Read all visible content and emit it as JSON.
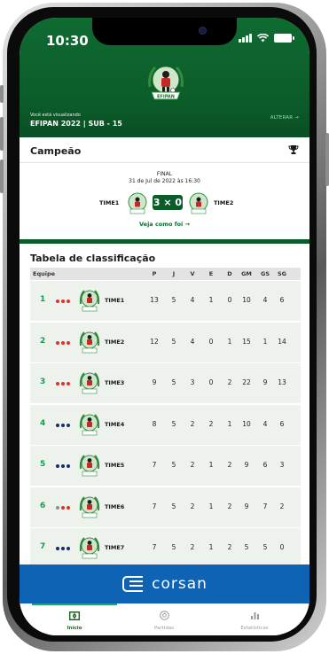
{
  "status": {
    "time": "10:30"
  },
  "header": {
    "logo_text": "EFIPAN",
    "viewing_label": "Você está visualizando",
    "viewing_value": "EFIPAN 2022 | SUB - 15",
    "change_label": "ALTERAR →"
  },
  "champion": {
    "title": "Campeão",
    "icon": "trophy-icon",
    "stage": "FINAL",
    "date": "31 de Jul de 2022 às 16:30",
    "home_team": "TIME1",
    "away_team": "TIME2",
    "score": "3 × 0",
    "see_how_label": "Veja como foi  →"
  },
  "standings": {
    "title": "Tabela de classificação",
    "columns": [
      "Equipe",
      "P",
      "J",
      "V",
      "E",
      "D",
      "GM",
      "GS",
      "SG"
    ],
    "rows": [
      {
        "pos": "1",
        "team": "TIME1",
        "form": [
          "#e0302b",
          "#e0302b",
          "#e0302b"
        ],
        "P": "13",
        "J": "5",
        "V": "4",
        "E": "1",
        "D": "0",
        "GM": "10",
        "GS": "4",
        "SG": "6"
      },
      {
        "pos": "2",
        "team": "TIME2",
        "form": [
          "#e0302b",
          "#e0302b",
          "#e0302b"
        ],
        "P": "12",
        "J": "5",
        "V": "4",
        "E": "0",
        "D": "1",
        "GM": "15",
        "GS": "1",
        "SG": "14"
      },
      {
        "pos": "3",
        "team": "TIME3",
        "form": [
          "#e0302b",
          "#e0302b",
          "#e0302b"
        ],
        "P": "9",
        "J": "5",
        "V": "3",
        "E": "0",
        "D": "2",
        "GM": "22",
        "GS": "9",
        "SG": "13"
      },
      {
        "pos": "4",
        "team": "TIME4",
        "form": [
          "#1b2b6b",
          "#1b2b6b",
          "#1b2b6b"
        ],
        "P": "8",
        "J": "5",
        "V": "2",
        "E": "2",
        "D": "1",
        "GM": "10",
        "GS": "4",
        "SG": "6"
      },
      {
        "pos": "5",
        "team": "TIME5",
        "form": [
          "#1b2b6b",
          "#1b2b6b",
          "#1b2b6b"
        ],
        "P": "7",
        "J": "5",
        "V": "2",
        "E": "1",
        "D": "2",
        "GM": "9",
        "GS": "6",
        "SG": "3"
      },
      {
        "pos": "6",
        "team": "TIME6",
        "form": [
          "#8c8c8c",
          "#e0302b",
          "#e0302b"
        ],
        "P": "7",
        "J": "5",
        "V": "2",
        "E": "1",
        "D": "2",
        "GM": "9",
        "GS": "7",
        "SG": "2"
      },
      {
        "pos": "7",
        "team": "TIME7",
        "form": [
          "#1b2b6b",
          "#1b2b6b",
          "#1b2b6b"
        ],
        "P": "7",
        "J": "5",
        "V": "2",
        "E": "1",
        "D": "2",
        "GM": "5",
        "GS": "5",
        "SG": "0"
      }
    ]
  },
  "sponsor": {
    "name": "corsan"
  },
  "tabs": [
    {
      "label": "Início",
      "icon": "field-icon",
      "active": true
    },
    {
      "label": "Partidas",
      "icon": "ball-icon",
      "active": false
    },
    {
      "label": "Estatísticas",
      "icon": "stats-icon",
      "active": false
    }
  ],
  "colors": {
    "header_green": "#0c5c2a",
    "position_green": "#12a04a",
    "sponsor_blue": "#0e63b4",
    "tab_active": "#1faa55"
  }
}
